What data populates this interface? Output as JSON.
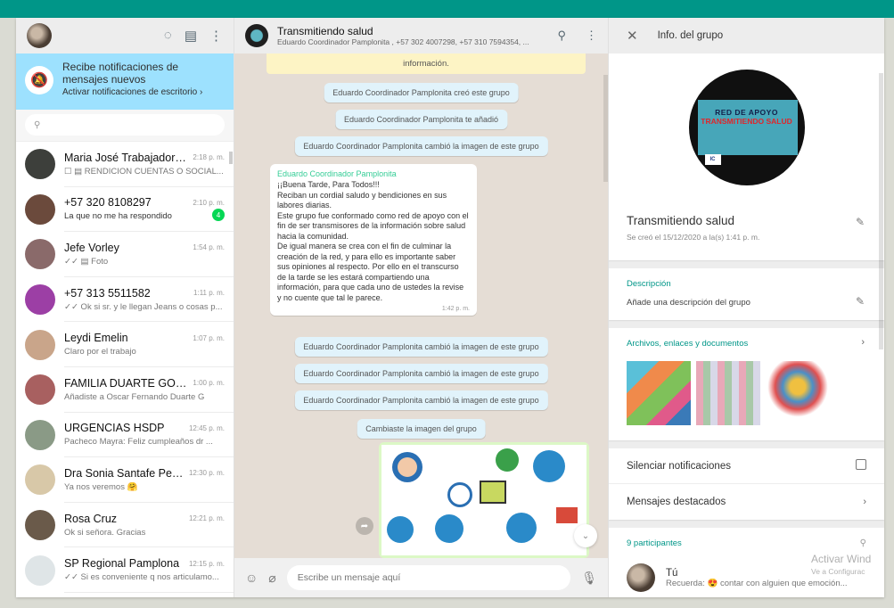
{
  "sidebar": {
    "notification": {
      "title": "Recibe notificaciones de mensajes nuevos",
      "action": "Activar notificaciones de escritorio ›"
    },
    "chats": [
      {
        "name": "Maria José Trabajadora...",
        "time": "2:18 p. m.",
        "preview": "☐ ▤ RENDICION CUENTAS O SOCIAL...",
        "avatar_color": "#3d3f3b"
      },
      {
        "name": "+57 320 8108297",
        "time": "2:10 p. m.",
        "preview": "La que no me ha respondido",
        "badge": "4",
        "avatar_color": "#6b4a3c"
      },
      {
        "name": "Jefe Vorley",
        "time": "1:54 p. m.",
        "preview": "✓✓ ▤ Foto",
        "avatar_color": "#8a6a6a"
      },
      {
        "name": "+57 313 5511582",
        "time": "1:11 p. m.",
        "preview": "✓✓ Ok si sr. y le llegan Jeans o cosas p...",
        "avatar_color": "#9c3fa5"
      },
      {
        "name": "Leydi Emelin",
        "time": "1:07 p. m.",
        "preview": "Claro por el trabajo",
        "avatar_color": "#c9a58a"
      },
      {
        "name": "FAMILIA DUARTE GONZ...",
        "time": "1:00 p. m.",
        "preview": "Añadiste a Oscar Fernando Duarte G",
        "avatar_color": "#a86060"
      },
      {
        "name": "URGENCIAS HSDP",
        "time": "12:45 p. m.",
        "preview": "Pacheco Mayra: Feliz cumpleaños dr ...",
        "avatar_color": "#8a9a86"
      },
      {
        "name": "Dra Sonia Santafe Ped...",
        "time": "12:30 p. m.",
        "preview": "Ya nos veremos 🤗",
        "avatar_color": "#d8c8a8"
      },
      {
        "name": "Rosa Cruz",
        "time": "12:21 p. m.",
        "preview": "Ok si señora. Gracias",
        "avatar_color": "#6a5a4a"
      },
      {
        "name": "SP Regional Pamplona",
        "time": "12:15 p. m.",
        "preview": "✓✓ Si es conveniente q nos articulamo...",
        "avatar_color": "#dfe5e7"
      }
    ]
  },
  "chat": {
    "group_name": "Transmitiendo salud",
    "members": "Eduardo Coordinador Pamplonita , +57 302 4007298, +57 310 7594354, ...",
    "banner": "información.",
    "system_top": [
      "Eduardo Coordinador Pamplonita creó este grupo",
      "Eduardo Coordinador Pamplonita te añadió",
      "Eduardo Coordinador Pamplonita cambió la imagen de este grupo"
    ],
    "message": {
      "author": "Eduardo Coordinador Pamplonita",
      "text": "¡¡Buena Tarde, Para Todos!!!\nReciban un cordial saludo y bendiciones en sus labores diarias.\nEste grupo fue conformado como red de apoyo con el fin de ser transmisores de la información sobre salud hacia la comunidad.\nDe igual manera se crea con el fin de culminar la creación de la red, y para ello es importante saber sus opiniones al respecto. Por ello en el transcurso de la tarde  se les estará compartiendo una información, para que cada uno de ustedes la revise y no cuente que tal le parece.",
      "time": "1:42 p. m."
    },
    "system_bottom": [
      "Eduardo Coordinador Pamplonita cambió la imagen de este grupo",
      "Eduardo Coordinador Pamplonita cambió la imagen de este grupo",
      "Eduardo Coordinador Pamplonita cambió la imagen de este grupo",
      "Cambiaste la imagen del grupo"
    ],
    "composer_placeholder": "Escribe un mensaje aquí"
  },
  "info": {
    "title": "Info. del grupo",
    "pic_line1": "RED DE APOYO",
    "pic_line2": "TRANSMITIENDO SALUD",
    "pic_badge": "IC",
    "group_name": "Transmitiendo salud",
    "created": "Se creó el 15/12/2020 a la(s) 1:41 p. m.",
    "desc_label": "Descripción",
    "desc_value": "Añade una descripción del grupo",
    "files_label": "Archivos, enlaces y documentos",
    "mute_label": "Silenciar notificaciones",
    "starred_label": "Mensajes destacados",
    "participants_label": "9 participantes",
    "me_name": "Tú",
    "me_status": "Recuerda: 😍 contar con alguien que emoción..."
  },
  "watermark": {
    "line1": "Activar Wind",
    "line2": "Ve a Configurac"
  },
  "colors": {
    "accent": "#009688",
    "notify_bg": "#9de1fe",
    "chat_bg": "#e5ddd5",
    "system_bubble": "#e1f3fb",
    "badge": "#06d755"
  }
}
